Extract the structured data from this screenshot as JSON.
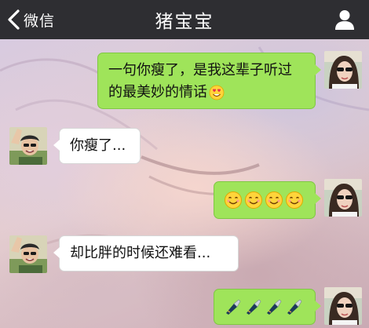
{
  "header": {
    "back_label": "微信",
    "title": "猪宝宝"
  },
  "messages": [
    {
      "direction": "out",
      "text": "一句你瘦了，是我这辈子听过的最美妙的情话",
      "trailing_emoji": "heart-eyes-emoji"
    },
    {
      "direction": "in",
      "text": "你瘦了..."
    },
    {
      "direction": "out",
      "emoji": [
        "smile-emoji",
        "smile-emoji",
        "smile-emoji",
        "smile-emoji"
      ]
    },
    {
      "direction": "in",
      "text": "却比胖的时候还难看..."
    },
    {
      "direction": "out",
      "emoji": [
        "knife-emoji",
        "knife-emoji",
        "knife-emoji",
        "knife-emoji"
      ]
    }
  ],
  "colors": {
    "header_bg": "#2e2e32",
    "outgoing_bubble": "#9fe45a",
    "incoming_bubble": "#ffffff"
  }
}
